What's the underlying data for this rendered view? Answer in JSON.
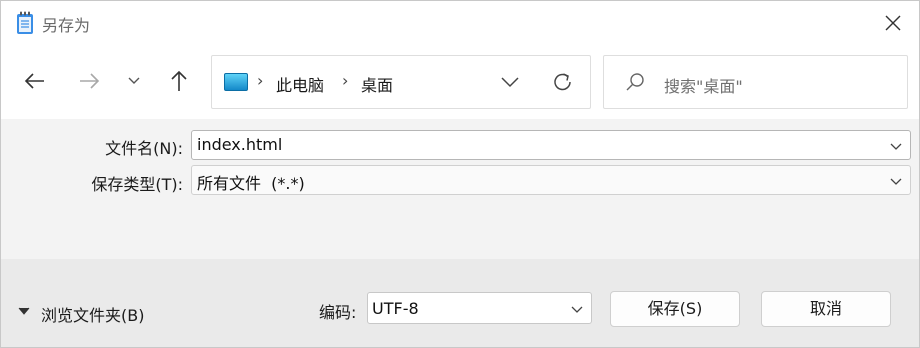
{
  "window": {
    "title": "另存为"
  },
  "address": {
    "crumbs": [
      "此电脑",
      "桌面"
    ],
    "separator": "›"
  },
  "search": {
    "placeholder": "搜索\"桌面\""
  },
  "form": {
    "filename_label": "文件名(N):",
    "filename_value": "index.html",
    "filetype_label": "保存类型(T):",
    "filetype_value": "所有文件  (*.*)"
  },
  "footer": {
    "browse_label": "浏览文件夹(B)",
    "encoding_label": "编码:",
    "encoding_value": "UTF-8",
    "save_label": "保存(S)",
    "cancel_label": "取消"
  },
  "icons": {
    "title": "notepad-icon",
    "close": "close-icon",
    "back": "back-arrow-icon",
    "forward": "forward-arrow-icon",
    "recent": "chevron-down-icon",
    "up": "up-arrow-icon",
    "pc": "this-pc-icon",
    "refresh": "refresh-icon",
    "search": "search-icon"
  }
}
